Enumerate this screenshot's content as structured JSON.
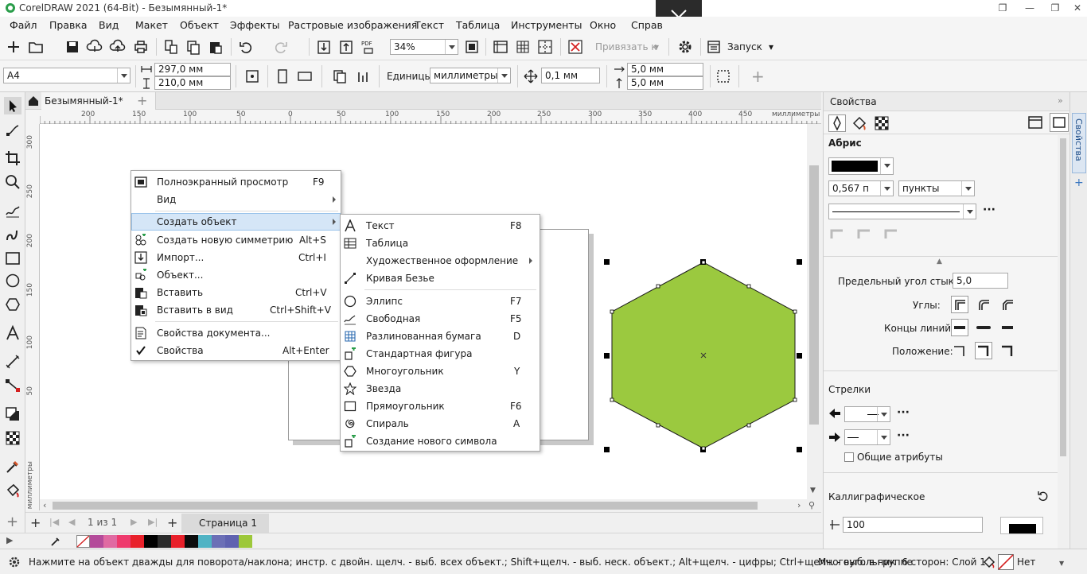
{
  "window": {
    "title": "CorelDRAW 2021 (64-Bit) - Безымянный-1*"
  },
  "menubar": [
    "Файл",
    "Правка",
    "Вид",
    "Макет",
    "Объект",
    "Эффекты",
    "Растровые изображения",
    "Текст",
    "Таблица",
    "Инструменты",
    "Окно",
    "Справ"
  ],
  "toolbar1": {
    "zoom": "34%",
    "snap_label": "Привязать к",
    "launch_label": "Запуск"
  },
  "toolbar2": {
    "page_size": "A4",
    "width": "297,0 мм",
    "height": "210,0 мм",
    "units_label": "Единицы:",
    "units_value": "миллиметры",
    "nudge": "0,1 мм",
    "dup_x": "5,0 мм",
    "dup_y": "5,0 мм"
  },
  "doc_tab": {
    "name": "Безымянный-1*"
  },
  "ruler": {
    "top_ticks": [
      "200",
      "150",
      "100",
      "50",
      "0",
      "50",
      "100",
      "150",
      "200",
      "250",
      "300",
      "350",
      "400",
      "450"
    ],
    "top_unit": "миллиметры",
    "left_ticks": [
      "300",
      "250",
      "200",
      "150",
      "100",
      "50"
    ],
    "left_unit": "миллиметры"
  },
  "pagebar": {
    "page_counter": "1 из 1",
    "page_tab": "Страница 1"
  },
  "palette": {
    "colors": [
      "#b44b9a",
      "#e06aa2",
      "#ee3a6d",
      "#e8202a",
      "#000000",
      "#2b2b2b",
      "#e8202a",
      "#0b0b0b",
      "#4fb3c4",
      "#6b6fb6",
      "#5f62b0",
      "#9dc83a"
    ]
  },
  "status": {
    "hint": "Нажмите на объект дважды для поворота/наклона; инстр. с двойн. щелч. - выб. всех объект.; Shift+щелч. - выб. неск. объект.; Alt+щелч. - цифры; Ctrl+щелч. - выб. в группе",
    "object_info": "Многоугольник  6 сторон: Слой 1",
    "fill_label": "Нет"
  },
  "properties": {
    "title": "Свойства",
    "section_outline": "Абрис",
    "width_value": "0,567 п",
    "width_unit": "пункты",
    "miter_label": "Предельный угол стыка:",
    "miter_value": "5,0",
    "corners_label": "Углы:",
    "line_caps_label": "Концы линий:",
    "position_label": "Положение:",
    "arrows_label": "Стрелки",
    "shared_attrs_label": "Общие атрибуты",
    "calligraphic_label": "Каллиграфическое",
    "calligraphic_value": "100",
    "docker_tab": "Свойства"
  },
  "context_menu": {
    "items": [
      {
        "label": "Полноэкранный просмотр",
        "shortcut": "F9"
      },
      {
        "label": "Вид",
        "shortcut": ""
      },
      {
        "label": "Создать объект",
        "shortcut": ""
      },
      {
        "label": "Создать новую симметрию",
        "shortcut": "Alt+S"
      },
      {
        "label": "Импорт...",
        "shortcut": "Ctrl+I"
      },
      {
        "label": "Объект...",
        "shortcut": ""
      },
      {
        "label": "Вставить",
        "shortcut": "Ctrl+V"
      },
      {
        "label": "Вставить в вид",
        "shortcut": "Ctrl+Shift+V"
      },
      {
        "label": "Свойства документа...",
        "shortcut": ""
      },
      {
        "label": "Свойства",
        "shortcut": "Alt+Enter"
      }
    ]
  },
  "submenu": {
    "items": [
      {
        "label": "Текст",
        "shortcut": "F8"
      },
      {
        "label": "Таблица",
        "shortcut": ""
      },
      {
        "label": "Художественное оформление",
        "shortcut": ""
      },
      {
        "label": "Кривая Безье",
        "shortcut": ""
      },
      {
        "label": "Эллипс",
        "shortcut": "F7"
      },
      {
        "label": "Свободная",
        "shortcut": "F5"
      },
      {
        "label": "Разлинованная бумага",
        "shortcut": "D"
      },
      {
        "label": "Стандартная фигура",
        "shortcut": ""
      },
      {
        "label": "Многоугольник",
        "shortcut": "Y"
      },
      {
        "label": "Звезда",
        "shortcut": ""
      },
      {
        "label": "Прямоугольник",
        "shortcut": "F6"
      },
      {
        "label": "Спираль",
        "shortcut": "A"
      },
      {
        "label": "Создание нового символа",
        "shortcut": ""
      }
    ]
  },
  "colors": {
    "hexagon_fill": "#9bc93f",
    "menu_highlight": "#d5e6f7"
  }
}
